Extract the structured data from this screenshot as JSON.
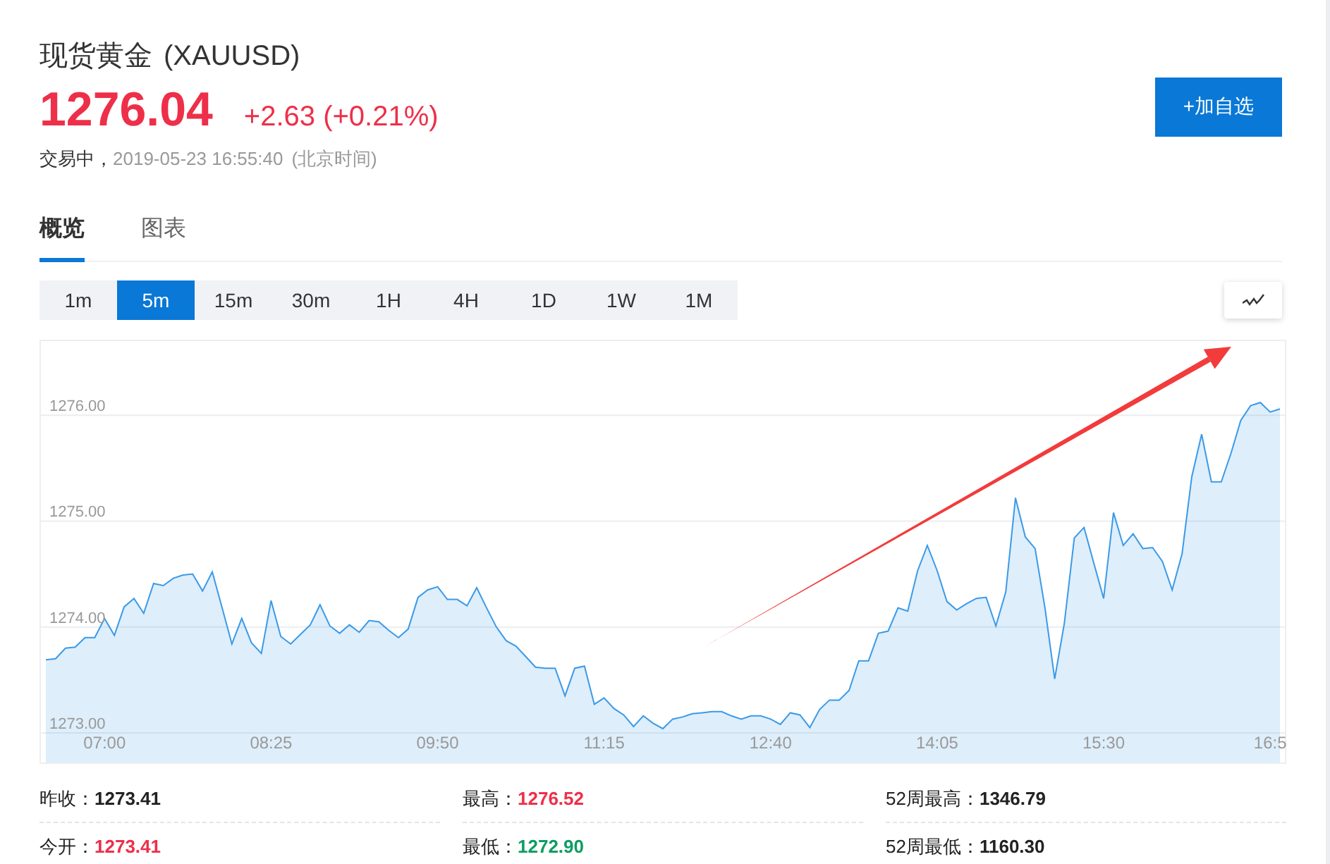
{
  "header": {
    "name": "现货黄金",
    "symbol": "(XAUUSD)",
    "price": "1276.04",
    "change": "+2.63 (+0.21%)",
    "status": "交易中，",
    "timestamp": "2019-05-23 16:55:40",
    "timezone": "(北京时间)",
    "add_button": "+加自选"
  },
  "tabs": [
    {
      "label": "概览",
      "selected": true
    },
    {
      "label": "图表",
      "selected": false
    }
  ],
  "intervals": [
    {
      "label": "1m",
      "selected": false
    },
    {
      "label": "5m",
      "selected": true
    },
    {
      "label": "15m",
      "selected": false
    },
    {
      "label": "30m",
      "selected": false
    },
    {
      "label": "1H",
      "selected": false
    },
    {
      "label": "4H",
      "selected": false
    },
    {
      "label": "1D",
      "selected": false
    },
    {
      "label": "1W",
      "selected": false
    },
    {
      "label": "1M",
      "selected": false
    }
  ],
  "chart": {
    "chart_data": {
      "type": "area",
      "grid": true,
      "ylim": [
        1272.72,
        1276.7
      ],
      "categories": [
        null,
        null,
        null,
        null,
        null,
        null,
        "07:00",
        null,
        null,
        null,
        null,
        null,
        null,
        null,
        null,
        null,
        null,
        null,
        null,
        null,
        null,
        null,
        null,
        "08:25",
        null,
        null,
        null,
        null,
        null,
        null,
        null,
        null,
        null,
        null,
        null,
        null,
        null,
        null,
        null,
        null,
        "09:50",
        null,
        null,
        null,
        null,
        null,
        null,
        null,
        null,
        null,
        null,
        null,
        null,
        null,
        null,
        null,
        null,
        "11:15",
        null,
        null,
        null,
        null,
        null,
        null,
        null,
        null,
        null,
        null,
        null,
        null,
        null,
        null,
        null,
        null,
        "12:40",
        null,
        null,
        null,
        null,
        null,
        null,
        null,
        null,
        null,
        null,
        null,
        null,
        null,
        null,
        null,
        null,
        "14:05",
        null,
        null,
        null,
        null,
        null,
        null,
        null,
        null,
        null,
        null,
        null,
        null,
        null,
        null,
        null,
        null,
        "15:30",
        null,
        null,
        null,
        null,
        null,
        null,
        null,
        null,
        null,
        null,
        null,
        null,
        null,
        null,
        null,
        null,
        "16:5",
        null
      ],
      "yticks": [
        {
          "value": 1273,
          "label": "1273.00"
        },
        {
          "value": 1274,
          "label": "1274.00"
        },
        {
          "value": 1275,
          "label": "1275.00"
        },
        {
          "value": 1276,
          "label": "1276.00"
        }
      ],
      "series": [
        {
          "color": "#3a9ae8",
          "values": [
            1273.69,
            1273.7,
            1273.8,
            1273.81,
            1273.9,
            1273.9,
            1274.08,
            1273.92,
            1274.19,
            1274.27,
            1274.13,
            1274.41,
            1274.39,
            1274.46,
            1274.49,
            1274.5,
            1274.34,
            1274.52,
            1274.18,
            1273.84,
            1274.08,
            1273.85,
            1273.75,
            1274.25,
            1273.91,
            1273.84,
            1273.93,
            1274.02,
            1274.21,
            1274.01,
            1273.94,
            1274.02,
            1273.95,
            1274.06,
            1274.05,
            1273.97,
            1273.9,
            1273.98,
            1274.28,
            1274.35,
            1274.38,
            1274.26,
            1274.26,
            1274.2,
            1274.37,
            1274.18,
            1274.0,
            1273.87,
            1273.82,
            1273.72,
            1273.62,
            1273.61,
            1273.61,
            1273.35,
            1273.61,
            1273.63,
            1273.27,
            1273.33,
            1273.23,
            1273.17,
            1273.06,
            1273.16,
            1273.09,
            1273.04,
            1273.13,
            1273.15,
            1273.18,
            1273.19,
            1273.2,
            1273.2,
            1273.16,
            1273.13,
            1273.16,
            1273.16,
            1273.13,
            1273.08,
            1273.19,
            1273.17,
            1273.05,
            1273.22,
            1273.31,
            1273.31,
            1273.4,
            1273.68,
            1273.68,
            1273.94,
            1273.96,
            1274.18,
            1274.15,
            1274.53,
            1274.77,
            1274.53,
            1274.24,
            1274.16,
            1274.22,
            1274.27,
            1274.28,
            1274.01,
            1274.33,
            1275.22,
            1274.85,
            1274.74,
            1274.18,
            1273.51,
            1274.04,
            1274.84,
            1274.94,
            1274.6,
            1274.27,
            1275.08,
            1274.77,
            1274.88,
            1274.74,
            1274.75,
            1274.62,
            1274.35,
            1274.69,
            1275.42,
            1275.82,
            1275.37,
            1275.37,
            1275.64,
            1275.95,
            1276.09,
            1276.12,
            1276.03,
            1276.06
          ]
        }
      ]
    }
  },
  "stats": [
    {
      "label": "昨收：",
      "value": "1273.41",
      "color": "#222222"
    },
    {
      "label": "最高：",
      "value": "1276.52",
      "color": "#ee2f49"
    },
    {
      "label": "52周最高：",
      "value": "1346.79",
      "color": "#222222"
    },
    {
      "label": "今开：",
      "value": "1273.41",
      "color": "#ee2f49"
    },
    {
      "label": "最低：",
      "value": "1272.90",
      "color": "#0e9d63"
    },
    {
      "label": "52周最低：",
      "value": "1160.30",
      "color": "#222222"
    }
  ]
}
